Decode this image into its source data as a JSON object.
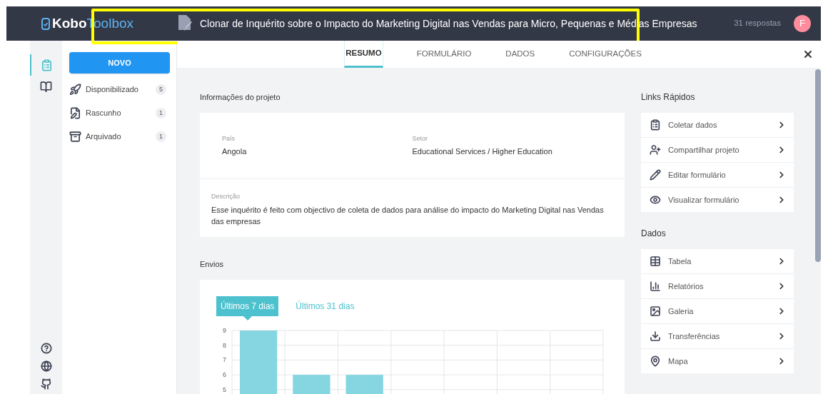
{
  "header": {
    "logo": {
      "bold": "Kobo",
      "light": "Toolbox"
    },
    "title": "Clonar de Inquérito sobre o Impacto do Marketing Digital nas Vendas para Micro, Pequenas e Médias Empresas",
    "responses": "31 respostas",
    "avatar": "F"
  },
  "rail": {
    "items": [
      {
        "selected": true
      },
      {
        "selected": false
      }
    ]
  },
  "sidebar": {
    "new_button": "NOVO",
    "items": [
      {
        "label": "Disponibilizado",
        "count": "5"
      },
      {
        "label": "Rascunho",
        "count": "1"
      },
      {
        "label": "Arquivado",
        "count": "1"
      }
    ]
  },
  "tabs": [
    {
      "label": "RESUMO",
      "selected": true
    },
    {
      "label": "FORMULÁRIO",
      "selected": false
    },
    {
      "label": "DADOS",
      "selected": false
    },
    {
      "label": "CONFIGURAÇÕES",
      "selected": false
    }
  ],
  "project_info": {
    "heading": "Informações do projeto",
    "fields": [
      {
        "label": "País",
        "value": "Angola"
      },
      {
        "label": "Setor",
        "value": "Educational Services / Higher Education"
      }
    ],
    "description": {
      "label": "Descrição",
      "value": "Esse inquérito é feito com objectivo de coleta de dados para análise do impacto do Marketing Digital nas Vendas das empresas"
    }
  },
  "submissions": {
    "heading": "Envios",
    "range_tabs": [
      {
        "label": "Últimos 7 dias",
        "selected": true
      },
      {
        "label": "Últimos 31 dias",
        "selected": false
      }
    ],
    "chart_data": {
      "type": "bar",
      "grid": true,
      "values": [
        9,
        6,
        6,
        null,
        null,
        null,
        null
      ],
      "ylim": [
        0,
        9
      ],
      "yticks": [
        5,
        6,
        7,
        8,
        9
      ]
    }
  },
  "quick_links": {
    "heading": "Links Rápidos",
    "items": [
      {
        "label": "Coletar dados"
      },
      {
        "label": "Compartilhar projeto"
      },
      {
        "label": "Editar formulário"
      },
      {
        "label": "Visualizar formulário"
      }
    ]
  },
  "data_links": {
    "heading": "Dados",
    "items": [
      {
        "label": "Tabela"
      },
      {
        "label": "Relatórios"
      },
      {
        "label": "Galeria"
      },
      {
        "label": "Transferências"
      },
      {
        "label": "Mapa"
      }
    ]
  }
}
